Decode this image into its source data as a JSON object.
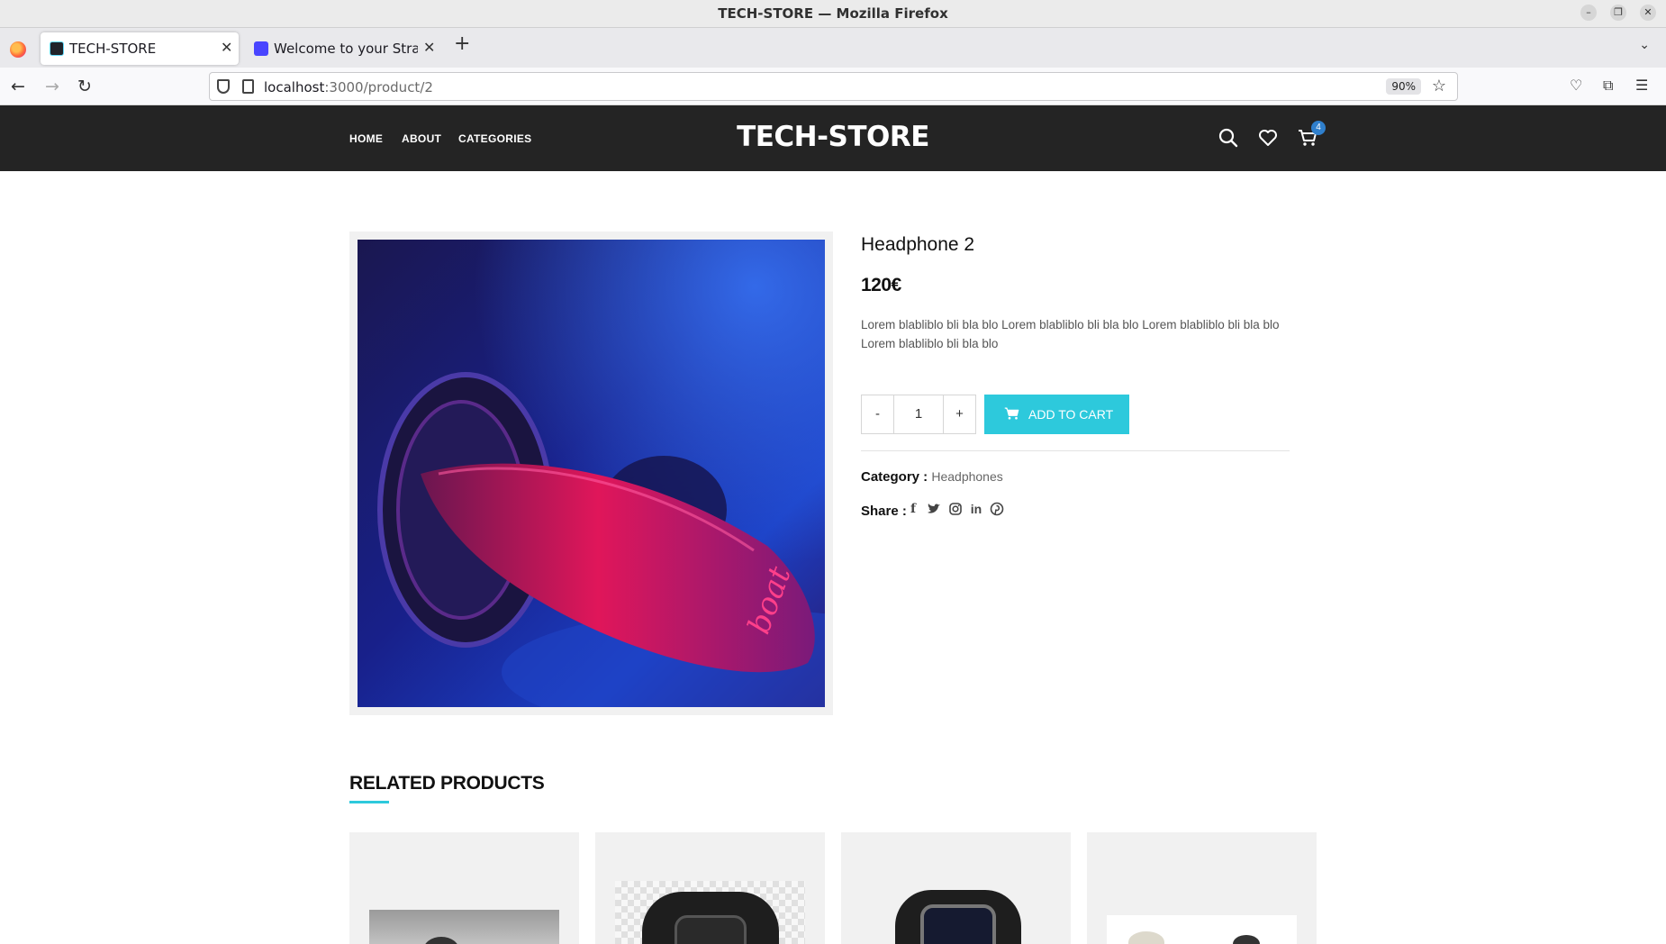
{
  "window": {
    "title": "TECH-STORE — Mozilla Firefox"
  },
  "tabs": [
    {
      "label": "TECH-STORE",
      "active": true
    },
    {
      "label": "Welcome to your Strapi a",
      "active": false
    }
  ],
  "urlbar": {
    "host": "localhost",
    "path": ":3000/product/2",
    "zoom": "90%"
  },
  "site": {
    "menu": [
      "HOME",
      "ABOUT",
      "CATEGORIES"
    ],
    "logo": "TECH-STORE",
    "cart_count": "4"
  },
  "product": {
    "name": "Headphone 2",
    "price": "120€",
    "description": "Lorem blabliblo bli bla blo Lorem blabliblo bli bla blo Lorem blabliblo bli bla blo Lorem blabliblo bli bla blo",
    "minus_label": "-",
    "quantity": "1",
    "plus_label": "+",
    "add_to_cart_label": "ADD TO CART",
    "category_label": "Category :",
    "category_value": "Headphones",
    "share_label": "Share :",
    "share_icons": [
      "facebook-icon",
      "twitter-icon",
      "instagram-icon",
      "linkedin-icon",
      "pinterest-icon"
    ],
    "image_text": "boat"
  },
  "related": {
    "title": "RELATED PRODUCTS"
  },
  "colors": {
    "header_bg": "#242424",
    "accent": "#2dc9dc",
    "badge": "#2f7fcc"
  }
}
